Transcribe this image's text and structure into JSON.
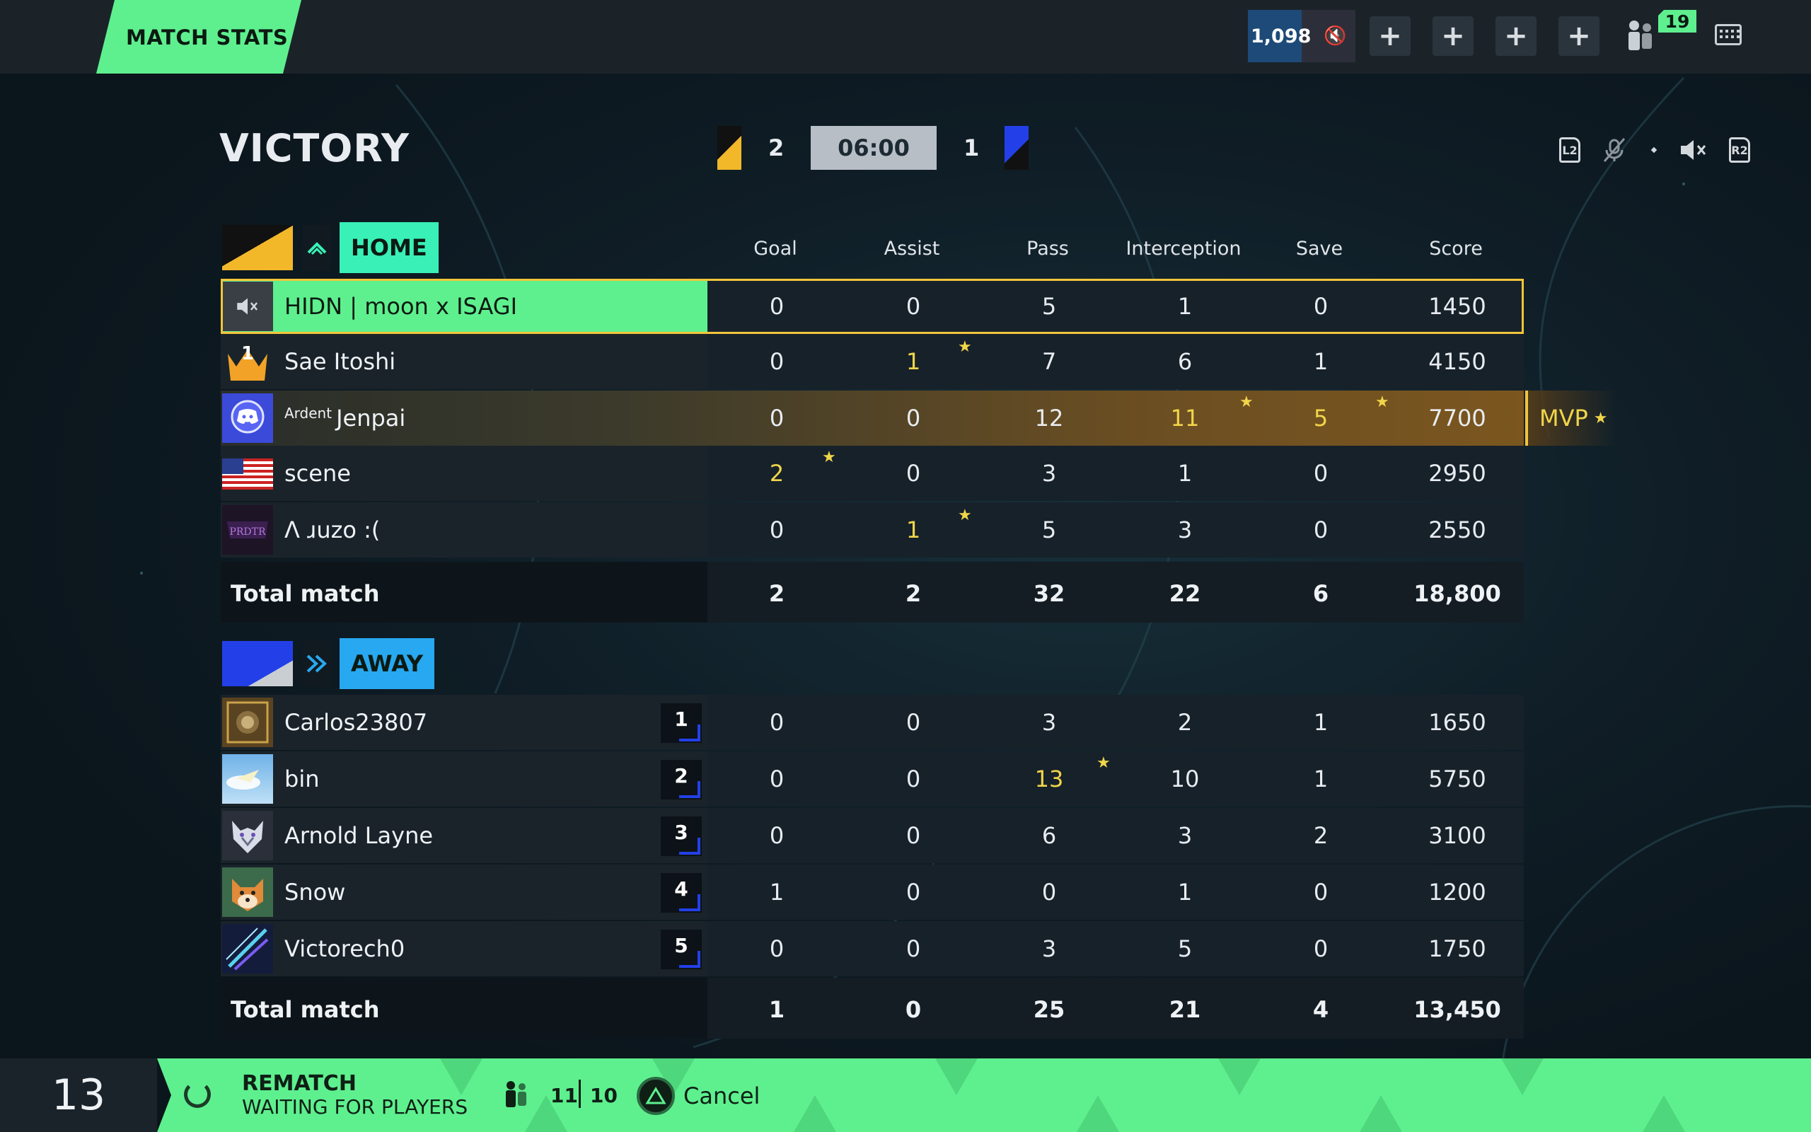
{
  "topbar": {
    "tab_label": "MATCH STATS",
    "coins": "1,098",
    "friends_count": "19",
    "plus_label": "+"
  },
  "header": {
    "result": "VICTORY",
    "home_score": "2",
    "away_score": "1",
    "timer": "06:00",
    "l2": "L2",
    "r2": "R2"
  },
  "columns": [
    "Goal",
    "Assist",
    "Pass",
    "Interception",
    "Save",
    "Score"
  ],
  "home": {
    "label": "HOME",
    "colors": {
      "flag_a": "#111111",
      "flag_b": "#f2b82a",
      "pill": "#39f0b6"
    },
    "players": [
      {
        "name": "HIDN | moon x ISAGI",
        "prefix": "",
        "stats": [
          "0",
          "0",
          "5",
          "1",
          "0",
          "1450"
        ],
        "highlight": [],
        "avatar": "muted-speaker-icon"
      },
      {
        "name": "Sae Itoshi",
        "prefix": "",
        "stats": [
          "0",
          "1",
          "7",
          "6",
          "1",
          "4150"
        ],
        "highlight": [
          1
        ],
        "avatar": "crown-icon"
      },
      {
        "name": "Jenpai",
        "prefix": "Ardent",
        "stats": [
          "0",
          "0",
          "12",
          "11",
          "5",
          "7700"
        ],
        "highlight": [
          3,
          4
        ],
        "avatar": "discord-icon"
      },
      {
        "name": "scene",
        "prefix": "",
        "stats": [
          "2",
          "0",
          "3",
          "1",
          "0",
          "2950"
        ],
        "highlight": [
          0
        ],
        "avatar": "us-flag-icon"
      },
      {
        "name": "Λ ɹuzo :(",
        "prefix": "",
        "stats": [
          "0",
          "1",
          "5",
          "3",
          "0",
          "2550"
        ],
        "highlight": [
          1
        ],
        "avatar": "predator-logo"
      }
    ],
    "total": {
      "label": "Total match",
      "stats": [
        "2",
        "2",
        "32",
        "22",
        "6",
        "18,800"
      ]
    },
    "mvp": "MVP"
  },
  "away": {
    "label": "AWAY",
    "colors": {
      "flag_a": "#2340e8",
      "flag_b": "#c9ced3",
      "pill": "#28a8f0"
    },
    "players": [
      {
        "name": "Carlos23807",
        "rank": "1",
        "stats": [
          "0",
          "0",
          "3",
          "2",
          "1",
          "1650"
        ],
        "highlight": [],
        "avatar": "coin-avatar"
      },
      {
        "name": "bin",
        "rank": "2",
        "stats": [
          "0",
          "0",
          "13",
          "10",
          "1",
          "5750"
        ],
        "highlight": [
          2
        ],
        "avatar": "sky-avatar"
      },
      {
        "name": "Arnold Layne",
        "rank": "3",
        "stats": [
          "0",
          "0",
          "6",
          "3",
          "2",
          "3100"
        ],
        "highlight": [],
        "avatar": "wolf-avatar"
      },
      {
        "name": "Snow",
        "rank": "4",
        "stats": [
          "1",
          "0",
          "0",
          "1",
          "0",
          "1200"
        ],
        "highlight": [],
        "avatar": "shiba-avatar"
      },
      {
        "name": "Victorech0",
        "rank": "5",
        "stats": [
          "0",
          "0",
          "3",
          "5",
          "0",
          "1750"
        ],
        "highlight": [],
        "avatar": "blade-avatar"
      }
    ],
    "total": {
      "label": "Total match",
      "stats": [
        "1",
        "0",
        "25",
        "21",
        "4",
        "13,450"
      ]
    }
  },
  "bottom": {
    "countdown": "13",
    "title": "REMATCH",
    "subtitle": "WAITING FOR PLAYERS",
    "players_a": "11",
    "players_b": "10",
    "cancel": "Cancel"
  },
  "colors": {
    "accent_green": "#5ef08e",
    "highlight_yellow": "#f1d54a",
    "outline_gold": "#f2c53a"
  }
}
